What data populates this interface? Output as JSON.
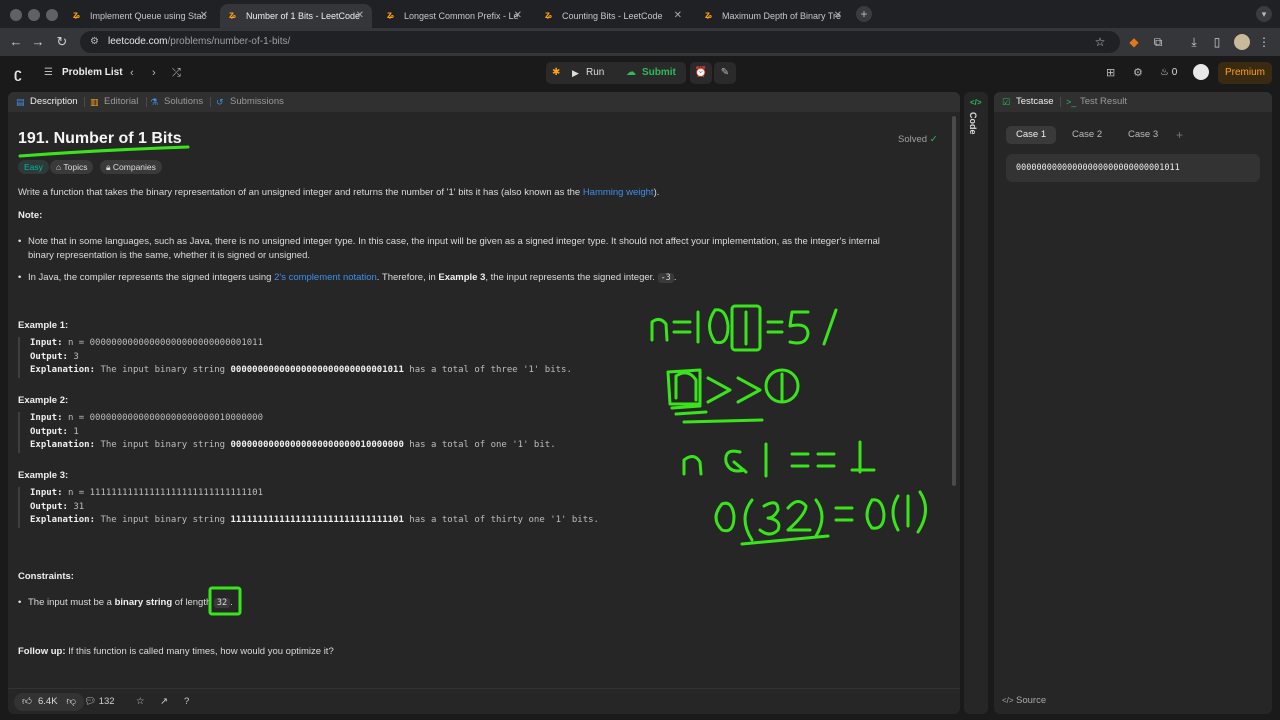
{
  "browser": {
    "tabs": [
      {
        "label": "Implement Queue using Stac",
        "active": false
      },
      {
        "label": "Number of 1 Bits - LeetCode",
        "active": true
      },
      {
        "label": "Longest Common Prefix - Le",
        "active": false
      },
      {
        "label": "Counting Bits - LeetCode",
        "active": false
      },
      {
        "label": "Maximum Depth of Binary Tre",
        "active": false
      }
    ],
    "url_host": "leetcode.com",
    "url_path": "/problems/number-of-1-bits/"
  },
  "header": {
    "problem_list": "Problem List",
    "run": "Run",
    "submit": "Submit",
    "streak": "0",
    "premium": "Premium"
  },
  "left_tabs": {
    "description": "Description",
    "editorial": "Editorial",
    "solutions": "Solutions",
    "submissions": "Submissions"
  },
  "problem": {
    "title": "191. Number of 1 Bits",
    "status": "Solved",
    "difficulty": "Easy",
    "topics": "Topics",
    "companies": "Companies",
    "desc_pre": "Write a function that takes the binary representation of an unsigned integer and returns the number of '1' bits it has (also known as the ",
    "desc_link": "Hamming weight",
    "desc_post": ").",
    "note_heading": "Note:",
    "note1": "Note that in some languages, such as Java, there is no unsigned integer type. In this case, the input will be given as a signed integer type. It should not affect your implementation, as the integer's internal binary representation is the same, whether it is signed or unsigned.",
    "note2_pre": "In Java, the compiler represents the signed integers using ",
    "note2_link": "2's complement notation",
    "note2_mid": ". Therefore, in ",
    "note2_bold": "Example 3",
    "note2_post": ", the input represents the signed integer. ",
    "note2_code": "-3",
    "note2_end": "."
  },
  "examples": [
    {
      "heading": "Example 1:",
      "input": "n = 00000000000000000000000000001011",
      "output": "3",
      "exp_pre": "The input binary string ",
      "exp_bold": "00000000000000000000000000001011",
      "exp_post": " has a total of three '1' bits."
    },
    {
      "heading": "Example 2:",
      "input": "n = 00000000000000000000000010000000",
      "output": "1",
      "exp_pre": "The input binary string ",
      "exp_bold": "00000000000000000000000010000000",
      "exp_post": " has a total of one '1' bit."
    },
    {
      "heading": "Example 3:",
      "input": "n = 11111111111111111111111111111101",
      "output": "31",
      "exp_pre": "The input binary string ",
      "exp_bold": "11111111111111111111111111111101",
      "exp_post": " has a total of thirty one '1' bits."
    }
  ],
  "labels": {
    "input": "Input:",
    "output": "Output:",
    "explanation": "Explanation:"
  },
  "constraints": {
    "heading": "Constraints:",
    "pre": "The input must be a ",
    "bold": "binary string",
    "mid": " of length ",
    "code": "32",
    "end": "."
  },
  "follow_up": {
    "label": "Follow up:",
    "text": " If this function is called many times, how would you optimize it?"
  },
  "footer": {
    "likes": "6.4K",
    "comments": "132"
  },
  "code_strip": {
    "label": "Code"
  },
  "right": {
    "testcase_tab": "Testcase",
    "result_tab": "Test Result",
    "cases": [
      "Case 1",
      "Case 2",
      "Case 3"
    ],
    "case_value": "00000000000000000000000000001011",
    "source": "Source"
  },
  "colors": {
    "accent_orange": "#ffa116",
    "accent_green": "#2cbb5d",
    "ink_green": "#39e51a",
    "link_blue": "#3e8fe9"
  }
}
